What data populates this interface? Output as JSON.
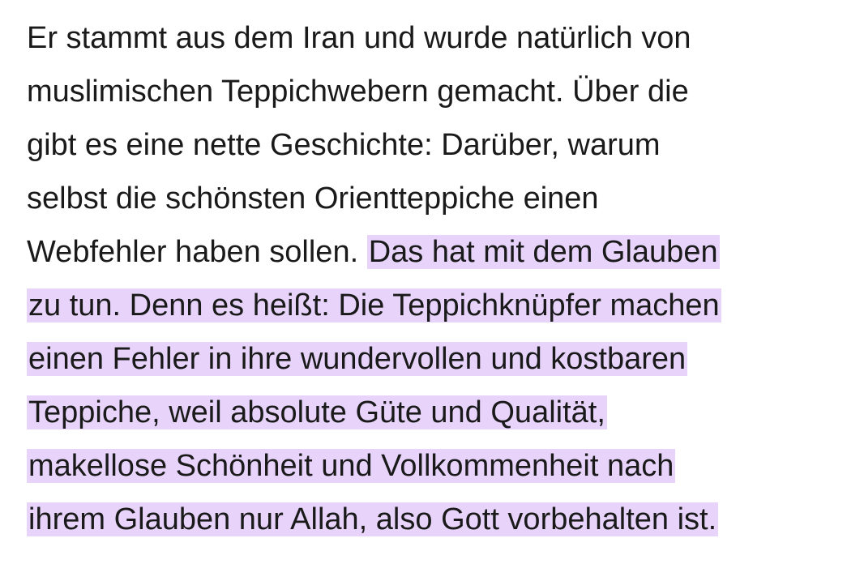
{
  "paragraph": {
    "lines": [
      {
        "plain": "Er stammt aus dem Iran und wurde natürlich von",
        "highlight": ""
      },
      {
        "plain": "muslimischen Teppichwebern gemacht. Über die",
        "highlight": ""
      },
      {
        "plain": "gibt es eine nette Geschichte: Darüber, warum",
        "highlight": ""
      },
      {
        "plain": "selbst die schönsten Orientteppiche einen",
        "highlight": ""
      },
      {
        "plain": "Webfehler haben sollen. ",
        "highlight": "Das hat mit dem Glauben"
      },
      {
        "plain": "",
        "highlight": "zu tun. Denn es heißt: Die Teppichknüpfer machen"
      },
      {
        "plain": "",
        "highlight": "einen Fehler in ihre wundervollen und kostbaren"
      },
      {
        "plain": "",
        "highlight": "Teppiche, weil absolute Güte und Qualität,"
      },
      {
        "plain": "",
        "highlight": "makellose Schönheit und Vollkommenheit nach"
      },
      {
        "plain": "",
        "highlight": "ihrem Glauben nur Allah, also Gott vorbehalten ist."
      }
    ]
  },
  "colors": {
    "text": "#1a1a1a",
    "highlight": "#e8d4fb",
    "background": "#ffffff"
  }
}
